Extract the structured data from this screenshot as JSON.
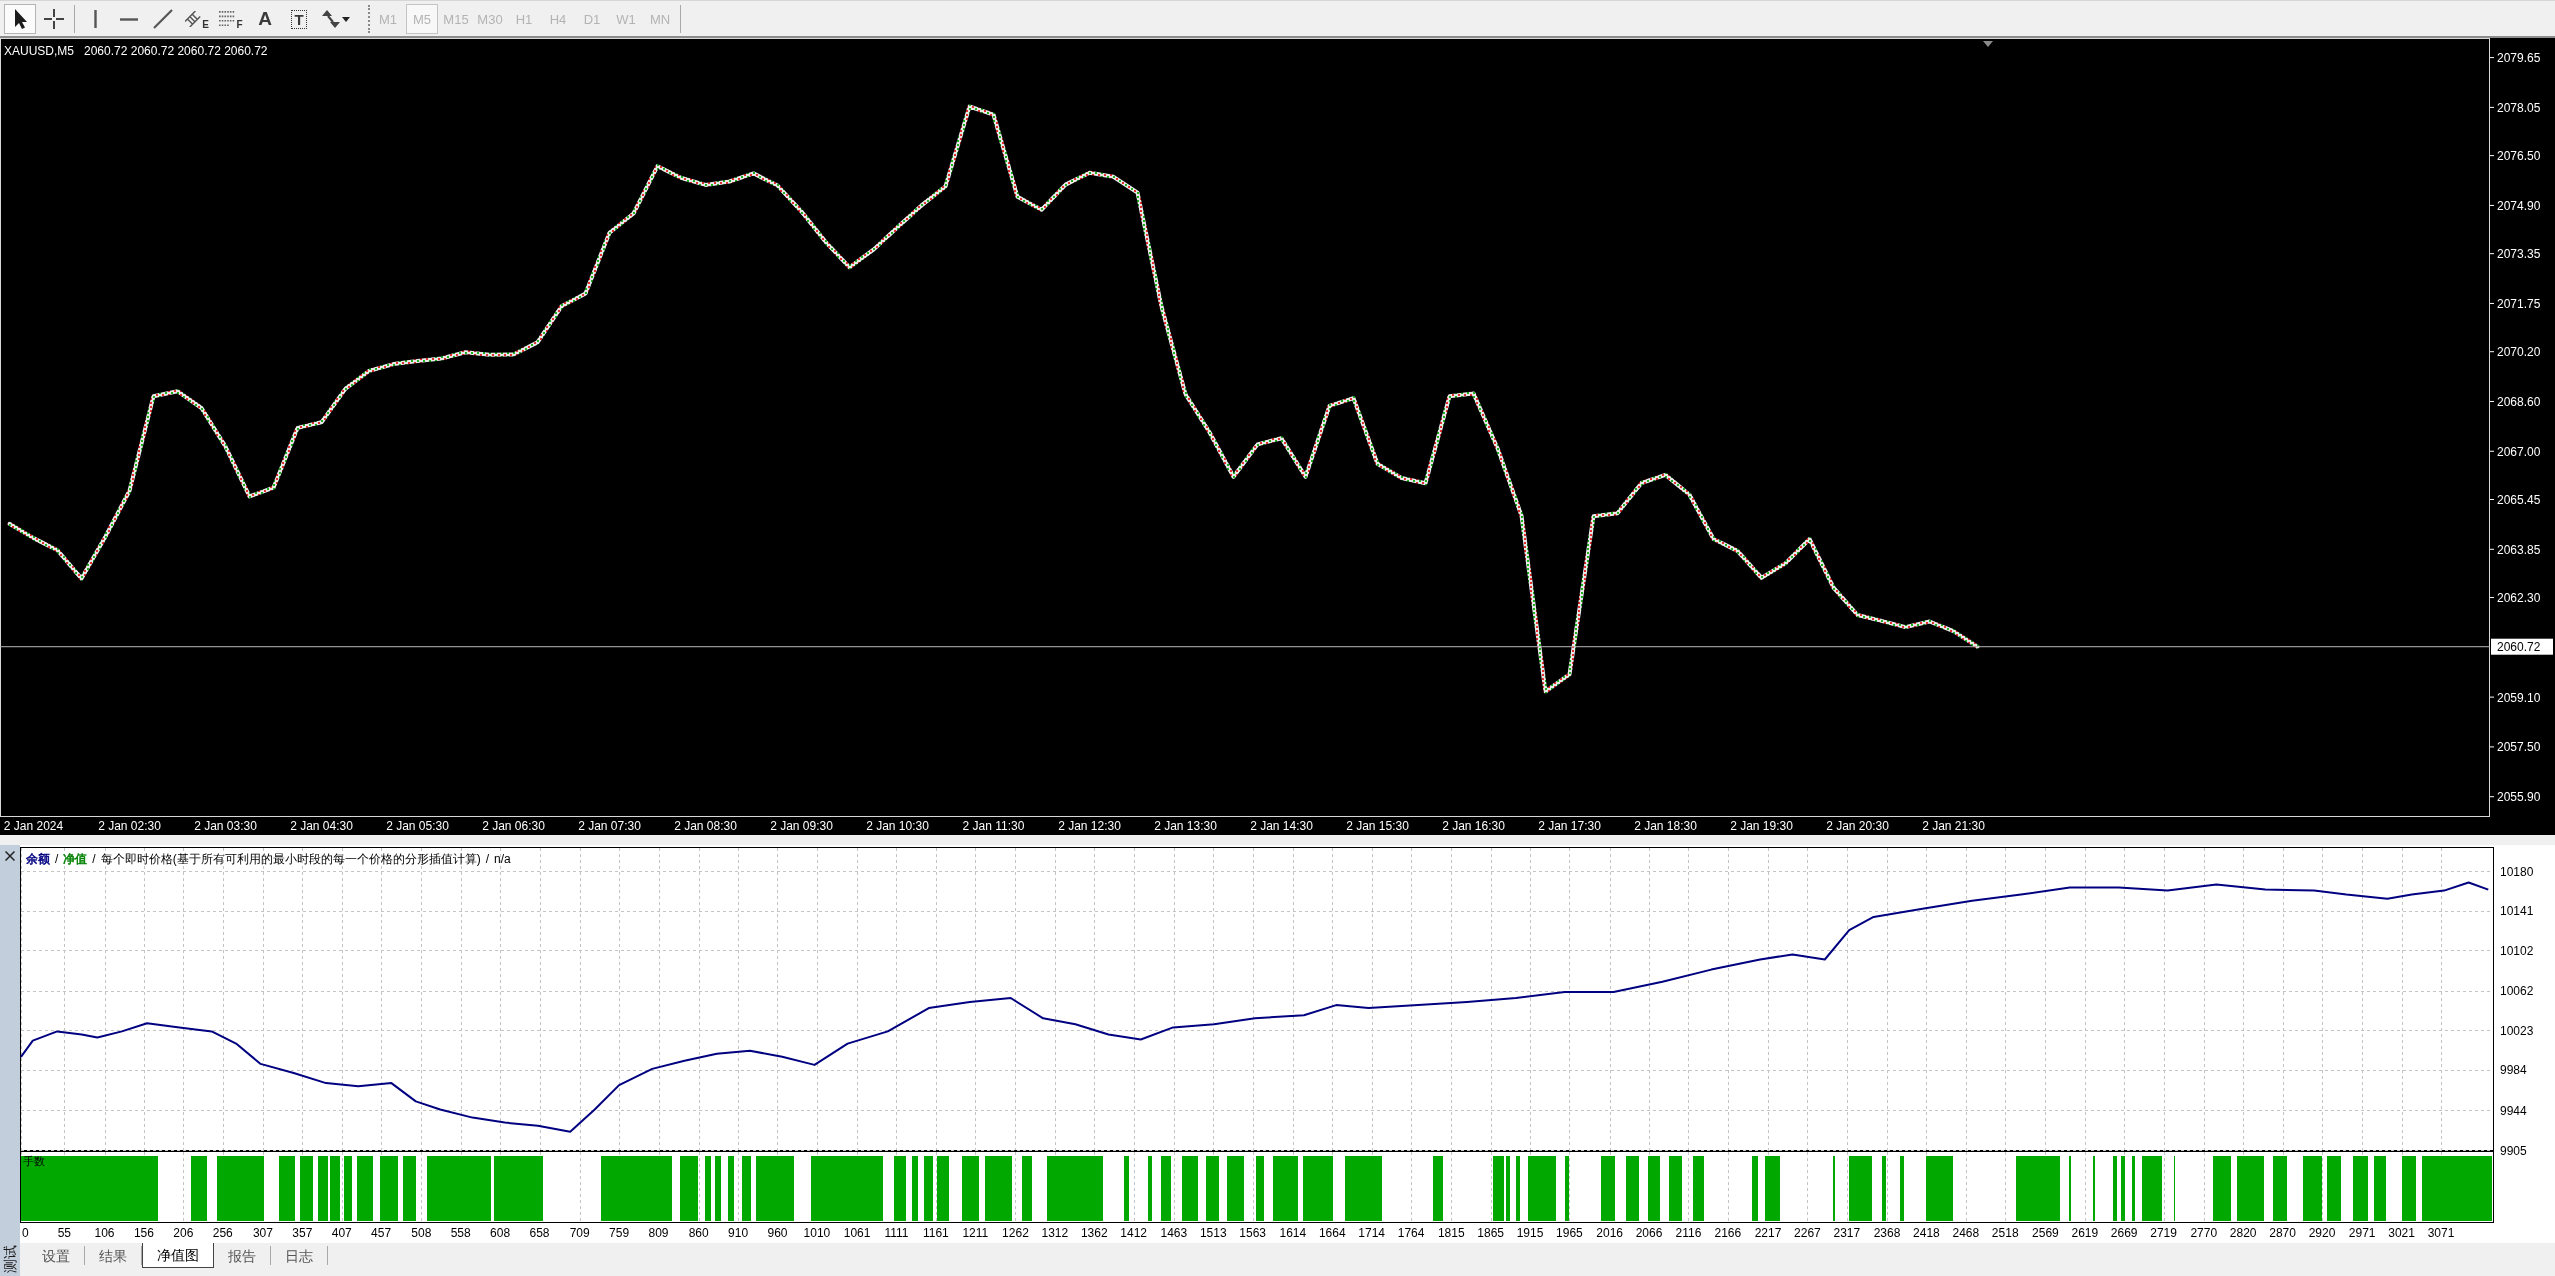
{
  "toolbar": {
    "tool_groups": [
      [
        {
          "kind": "cursor",
          "selected": true
        },
        {
          "kind": "crosshair",
          "selected": false
        }
      ],
      [
        {
          "kind": "vline",
          "selected": false
        },
        {
          "kind": "hline",
          "selected": false
        },
        {
          "kind": "trendline",
          "selected": false
        },
        {
          "kind": "channel",
          "badge": "E",
          "selected": false
        },
        {
          "kind": "fibo",
          "badge": "F",
          "selected": false
        },
        {
          "kind": "text",
          "glyph": "A",
          "selected": false
        },
        {
          "kind": "label",
          "glyph": "T",
          "selected": false
        },
        {
          "kind": "arrows",
          "dropdown": true,
          "selected": false
        }
      ]
    ],
    "periods": [
      {
        "label": "M1",
        "selected": false,
        "disabled": true
      },
      {
        "label": "M5",
        "selected": true,
        "disabled": true
      },
      {
        "label": "M15",
        "selected": false,
        "disabled": true
      },
      {
        "label": "M30",
        "selected": false,
        "disabled": true
      },
      {
        "label": "H1",
        "selected": false,
        "disabled": true
      },
      {
        "label": "H4",
        "selected": false,
        "disabled": true
      },
      {
        "label": "D1",
        "selected": false,
        "disabled": true
      },
      {
        "label": "W1",
        "selected": false,
        "disabled": true
      },
      {
        "label": "MN",
        "selected": false,
        "disabled": true
      }
    ]
  },
  "price_chart": {
    "header": {
      "symbol": "XAUUSD,M5",
      "prices": "2060.72 2060.72 2060.72 2060.72"
    },
    "chart_data": {
      "type": "line",
      "categories": [
        null,
        "2 Jan 2024",
        null,
        null,
        null,
        "2 Jan 02:30",
        null,
        null,
        null,
        "2 Jan 03:30",
        null,
        null,
        null,
        "2 Jan 04:30",
        null,
        null,
        null,
        "2 Jan 05:30",
        null,
        null,
        null,
        "2 Jan 06:30",
        null,
        null,
        null,
        "2 Jan 07:30",
        null,
        null,
        null,
        "2 Jan 08:30",
        null,
        null,
        null,
        "2 Jan 09:30",
        null,
        null,
        null,
        "2 Jan 10:30",
        null,
        null,
        null,
        "2 Jan 11:30",
        null,
        null,
        null,
        "2 Jan 12:30",
        null,
        null,
        null,
        "2 Jan 13:30",
        null,
        null,
        null,
        "2 Jan 14:30",
        null,
        null,
        null,
        "2 Jan 15:30",
        null,
        null,
        null,
        "2 Jan 16:30",
        null,
        null,
        null,
        "2 Jan 17:30",
        null,
        null,
        null,
        "2 Jan 18:30",
        null,
        null,
        null,
        "2 Jan 19:30",
        null,
        null,
        null,
        "2 Jan 20:30",
        null,
        null,
        null,
        "2 Jan 21:30",
        null
      ],
      "series": [
        {
          "values": [
            2064.67,
            2064.21,
            2063.82,
            2062.91,
            2064.26,
            2065.73,
            2068.77,
            2068.93,
            2068.39,
            2067.15,
            2065.55,
            2065.83,
            2067.75,
            2067.93,
            2069.01,
            2069.59,
            2069.8,
            2069.9,
            2069.98,
            2070.18,
            2070.1,
            2070.11,
            2070.5,
            2071.66,
            2072.07,
            2074.02,
            2074.64,
            2076.16,
            2075.78,
            2075.56,
            2075.67,
            2075.93,
            2075.54,
            2074.7,
            2073.73,
            2072.91,
            2073.48,
            2074.2,
            2074.9,
            2075.51,
            2078.08,
            2077.82,
            2075.18,
            2074.76,
            2075.57,
            2075.95,
            2075.82,
            2075.31,
            2071.65,
            2068.83,
            2067.61,
            2066.18,
            2067.22,
            2067.42,
            2066.18,
            2068.46,
            2068.71,
            2066.6,
            2066.14,
            2065.97,
            2068.77,
            2068.86,
            2067.1,
            2064.93,
            2059.28,
            2059.83,
            2064.91,
            2065.01,
            2065.98,
            2066.24,
            2065.6,
            2064.18,
            2063.8,
            2062.93,
            2063.4,
            2064.18,
            2062.62,
            2061.74,
            2061.55,
            2061.35,
            2061.53,
            2061.22,
            2060.72
          ]
        }
      ],
      "ylim": [
        2055.28,
        2080.28
      ],
      "yticks": [
        {
          "value": 2079.65,
          "label": "2079.65"
        },
        {
          "value": 2078.05,
          "label": "2078.05"
        },
        {
          "value": 2076.5,
          "label": "2076.50"
        },
        {
          "value": 2074.9,
          "label": "2074.90"
        },
        {
          "value": 2073.35,
          "label": "2073.35"
        },
        {
          "value": 2071.75,
          "label": "2071.75"
        },
        {
          "value": 2070.2,
          "label": "2070.20"
        },
        {
          "value": 2068.6,
          "label": "2068.60"
        },
        {
          "value": 2067.0,
          "label": "2067.00"
        },
        {
          "value": 2065.45,
          "label": "2065.45"
        },
        {
          "value": 2063.85,
          "label": "2063.85"
        },
        {
          "value": 2062.3,
          "label": "2062.30"
        },
        {
          "value": 2059.1,
          "label": "2059.10"
        },
        {
          "value": 2057.5,
          "label": "2057.50"
        },
        {
          "value": 2055.9,
          "label": "2055.90"
        }
      ],
      "ref_lines": [
        {
          "axis": "y",
          "value": 2060.72,
          "label": "2060.72"
        }
      ]
    }
  },
  "equity_chart": {
    "legend": [
      {
        "text": "余额",
        "color": "#000080"
      },
      {
        "text": "/"
      },
      {
        "text": "净值",
        "color": "#008000"
      },
      {
        "text": "/"
      },
      {
        "text": "每个即时价格(基于所有可利用的最小时段的每一个价格的分形插值计算)"
      },
      {
        "text": "/"
      },
      {
        "text": "n/a"
      }
    ],
    "chart_data": {
      "type": "line",
      "x": [
        0,
        15,
        46,
        77,
        97,
        128,
        160,
        201,
        242,
        273,
        304,
        346,
        387,
        428,
        470,
        501,
        532,
        573,
        614,
        656,
        697,
        728,
        759,
        801,
        842,
        883,
        925,
        966,
        1007,
        1049,
        1100,
        1152,
        1204,
        1256,
        1297,
        1338,
        1380,
        1421,
        1462,
        1514,
        1566,
        1628,
        1669,
        1710,
        1773,
        1835,
        1897,
        1959,
        2021,
        2083,
        2145,
        2207,
        2248,
        2289,
        2320,
        2351,
        2413,
        2476,
        2538,
        2600,
        2662,
        2724,
        2786,
        2848,
        2910,
        2951,
        3003,
        3034,
        3075,
        3106,
        3131
      ],
      "series": [
        {
          "color": "#000080",
          "values": [
            9997,
            10013,
            10022,
            10019,
            10016,
            10022,
            10030,
            10026,
            10022,
            10010,
            9990,
            9981,
            9971,
            9968,
            9971,
            9953,
            9945,
            9937,
            9932,
            9929,
            9923,
            9945,
            9969,
            9985,
            9993,
            10000,
            10003,
            9997,
            9989,
            10010,
            10022,
            10045,
            10051,
            10055,
            10035,
            10029,
            10019,
            10014,
            10026,
            10029,
            10035,
            10038,
            10048,
            10045,
            10048,
            10051,
            10055,
            10061,
            10061,
            10071,
            10083,
            10093,
            10098,
            10093,
            10122,
            10135,
            10143,
            10151,
            10157,
            10164,
            10164,
            10161,
            10167,
            10162,
            10161,
            10157,
            10153,
            10157,
            10161,
            10169,
            10162
          ]
        }
      ],
      "xlim": [
        0,
        3137
      ],
      "ylim": [
        9905,
        10203
      ],
      "grid": true,
      "xticks": [
        0,
        55,
        106,
        156,
        206,
        256,
        307,
        357,
        407,
        457,
        508,
        558,
        608,
        658,
        709,
        759,
        809,
        860,
        910,
        960,
        1010,
        1061,
        1111,
        1161,
        1211,
        1262,
        1312,
        1362,
        1412,
        1463,
        1513,
        1563,
        1614,
        1664,
        1714,
        1764,
        1815,
        1865,
        1915,
        1965,
        2016,
        2066,
        2116,
        2166,
        2217,
        2267,
        2317,
        2368,
        2418,
        2468,
        2518,
        2569,
        2619,
        2669,
        2719,
        2770,
        2820,
        2870,
        2920,
        2971,
        3021,
        3071
      ],
      "yticks": [
        10180,
        10141,
        10102,
        10062,
        10023,
        9984,
        9944,
        9905
      ]
    },
    "lots_panel": {
      "label": "手数"
    }
  },
  "tester": {
    "panel_title": "测试",
    "tabs": [
      {
        "label": "设置",
        "selected": false
      },
      {
        "label": "结果",
        "selected": false
      },
      {
        "label": "净值图",
        "selected": true
      },
      {
        "label": "报告",
        "selected": false
      },
      {
        "label": "日志",
        "selected": false
      }
    ]
  }
}
